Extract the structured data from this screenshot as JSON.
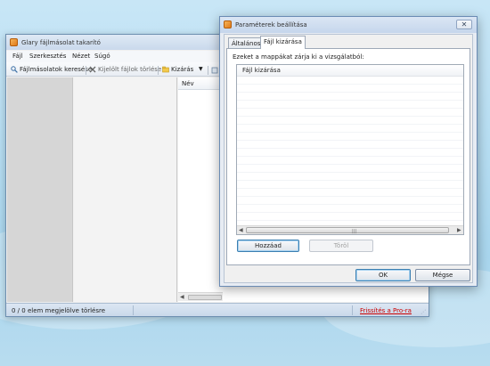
{
  "main_window": {
    "title": "Glary fájlmásolat takarító",
    "menu": [
      "Fájl",
      "Szerkesztés",
      "Nézet",
      "Súgó"
    ],
    "toolbar": {
      "find_label": "Fájlmásolatok keresése",
      "delete_label": "Kijelölt fájlok törlése",
      "exclude_label": "Kizárás"
    },
    "list": {
      "column_name": "Név"
    },
    "status": {
      "text": "0 / 0 elem megjelölve törlésre",
      "upgrade_link": "Frissítés a Pro-ra"
    }
  },
  "dialog": {
    "title": "Paraméterek beállítása",
    "tabs": [
      "Általános",
      "Fájl kizárása"
    ],
    "active_tab": "Fájl kizárása",
    "instructions": "Ezeket a mappákat zárja ki a vizsgálatból:",
    "list_header": "Fájl kizárása",
    "buttons": {
      "add": "Hozzáad",
      "remove": "Töröl",
      "ok": "OK",
      "cancel": "Mégse"
    }
  },
  "colors": {
    "desktop": "#b9dff3",
    "accent": "#3c7fb1",
    "link": "#cc0000",
    "app_icon": "#e07a18"
  }
}
